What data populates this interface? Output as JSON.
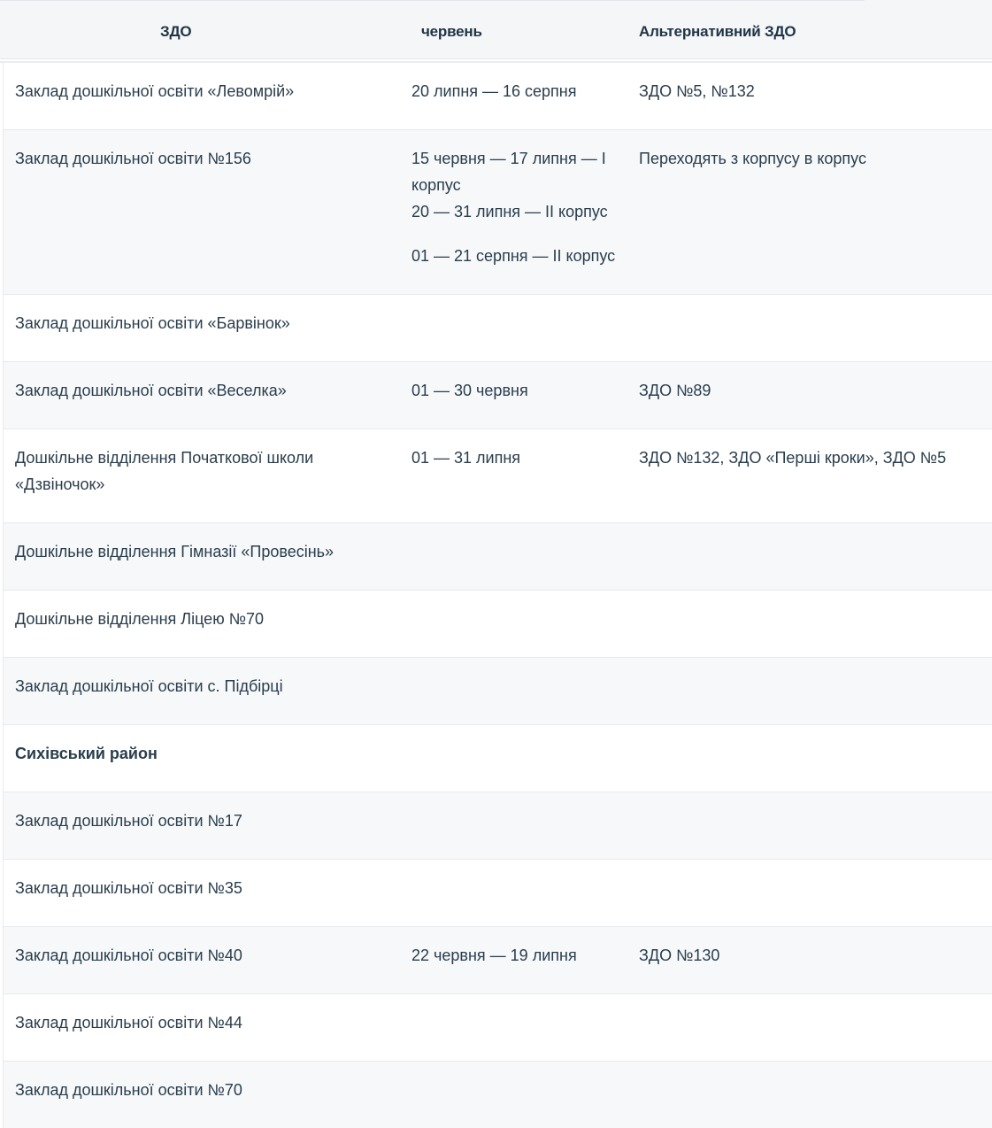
{
  "header": {
    "col1": "ЗДО",
    "col2": "червень",
    "col3": "Альтернативний ЗДО"
  },
  "rows": [
    {
      "name": "Заклад дошкільної освіти «Левомрій»",
      "dates": [
        "20 липня — 16 серпня"
      ],
      "alt": "ЗДО №5, №132"
    },
    {
      "name": "Заклад дошкільної освіти №156",
      "dates": [
        "15 червня — 17 липня — I корпус",
        "20 — 31 липня — II корпус",
        "01 — 21 серпня — II корпус"
      ],
      "alt": "Переходять з корпусу в корпус"
    },
    {
      "name": "Заклад дошкільної освіти «Барвінок»",
      "dates": [],
      "alt": ""
    },
    {
      "name": "Заклад дошкільної освіти «Веселка»",
      "dates": [
        "01 — 30 червня"
      ],
      "alt": "ЗДО №89"
    },
    {
      "name": "Дошкільне відділення Початкової школи «Дзвіночок»",
      "dates": [
        "01 — 31 липня"
      ],
      "alt": "ЗДО №132, ЗДО «Перші кроки», ЗДО №5"
    },
    {
      "name": "Дошкільне відділення Гімназії «Провесінь»",
      "dates": [],
      "alt": ""
    },
    {
      "name": "Дошкільне відділення Ліцею №70",
      "dates": [],
      "alt": ""
    },
    {
      "name": "Заклад дошкільної освіти с. Підбірці",
      "dates": [],
      "alt": ""
    },
    {
      "name": "Сихівський район",
      "dates": [],
      "alt": ""
    },
    {
      "name": "Заклад дошкільної освіти №17",
      "dates": [],
      "alt": ""
    },
    {
      "name": "Заклад дошкільної освіти №35",
      "dates": [],
      "alt": ""
    },
    {
      "name": "Заклад дошкільної освіти №40",
      "dates": [
        "22 червня — 19 липня"
      ],
      "alt": "ЗДО №130"
    },
    {
      "name": "Заклад дошкільної освіти №44",
      "dates": [],
      "alt": ""
    },
    {
      "name": "Заклад дошкільної освіти №70",
      "dates": [],
      "alt": ""
    }
  ]
}
